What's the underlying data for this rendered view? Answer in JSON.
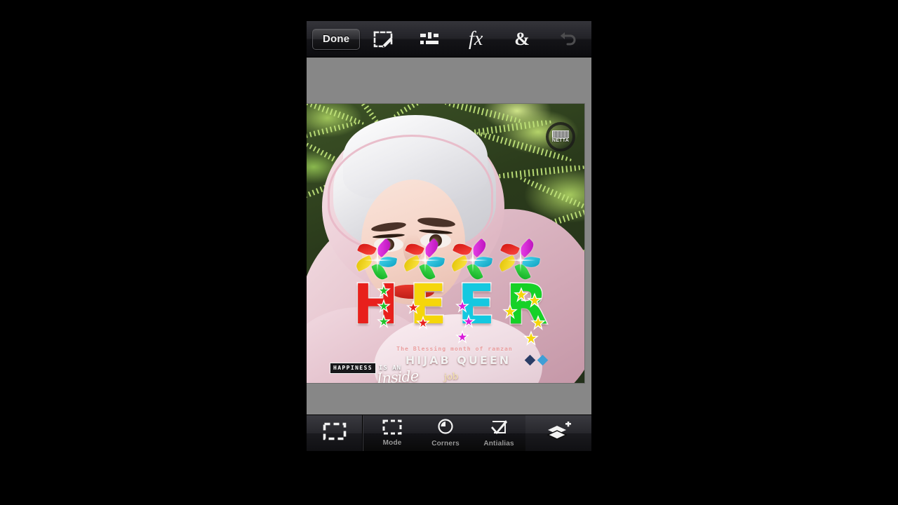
{
  "app": {
    "name": "Photo Editor",
    "background_color": "#000000",
    "frame_background": "#878787"
  },
  "top_toolbar": {
    "done_label": "Done",
    "items": [
      {
        "name": "selection-tool",
        "icon": "selection-pencil-icon",
        "label": "",
        "enabled": true
      },
      {
        "name": "adjust-tool",
        "icon": "sliders-icon",
        "label": "",
        "enabled": true
      },
      {
        "name": "effects-tool",
        "icon": "fx-icon",
        "label": "fx",
        "enabled": true
      },
      {
        "name": "blend-tool",
        "icon": "ampersand-icon",
        "label": "&",
        "enabled": true
      },
      {
        "name": "undo-tool",
        "icon": "undo-arrow-icon",
        "label": "",
        "enabled": false
      }
    ]
  },
  "bottom_toolbar": {
    "selection_tool_icon": "marquee-dashed-icon",
    "items": [
      {
        "name": "mode",
        "label": "Mode",
        "icon": "marquee-dashed-icon"
      },
      {
        "name": "corners",
        "label": "Corners",
        "icon": "rounded-corner-icon"
      },
      {
        "name": "antialias",
        "label": "Antialias",
        "icon": "checkmark-icon"
      }
    ],
    "add_layer_icon": "layers-plus-icon"
  },
  "canvas": {
    "photo_description": "Woman wearing pink and white hijab in front of green ferns",
    "watermark": {
      "text": "NETTA",
      "shape": "circular-badge"
    },
    "overlay": {
      "headline": "HEER",
      "headline_letters": [
        {
          "char": "H",
          "fill": "#e8201c",
          "accent": "#1fc22a",
          "accent_shape": "star"
        },
        {
          "char": "E",
          "fill": "#f5d60b",
          "accent": "#e8201c",
          "accent_shape": "star"
        },
        {
          "char": "E",
          "fill": "#14c8e0",
          "accent": "#d81ad8",
          "accent_shape": "star"
        },
        {
          "char": "R",
          "fill": "#16d127",
          "accent": "#f5d60b",
          "accent_shape": "star"
        }
      ],
      "flower_count": 4,
      "flower_petal_colors": [
        "#e8201c",
        "#d81ad8",
        "#14c8e0",
        "#16d127",
        "#f5d60b"
      ],
      "tagline": "The Blessing month of ramzan",
      "subtitle": "HIJAB QUEEN",
      "badge_text": "HAPPINESS",
      "badge_tail": "IS AN",
      "script_word": "Inside",
      "arabic_word": "job",
      "diamond_colors": [
        "#2b3d66",
        "#3f9fd6"
      ]
    }
  }
}
